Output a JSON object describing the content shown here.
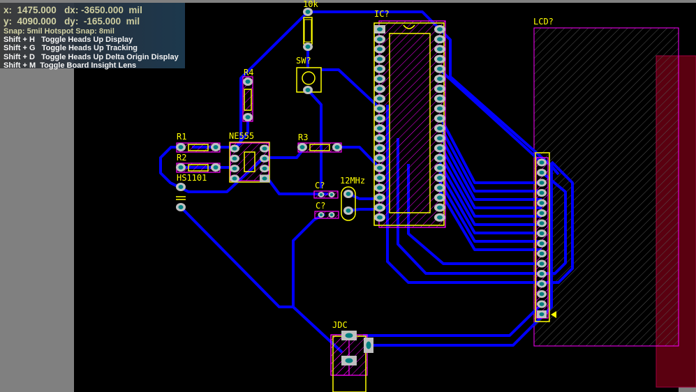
{
  "hud": {
    "x_line": "x:  1475.000   dx: -3650.000  mil",
    "y_line": "y:  4090.000   dy:  -165.000  mil",
    "snap": "Snap: 5mil Hotspot Snap: 8mil",
    "shortcuts": [
      "Shift + H   Toggle Heads Up Display",
      "Shift + G   Toggle Heads Up Tracking",
      "Shift + D   Toggle Heads Up Delta Origin Display",
      "Shift + M  Toggle Board Insight Lens"
    ]
  },
  "components": {
    "r10k": "10k",
    "ic": "IC?",
    "lcd": "LCD?",
    "sw": "SW?",
    "r4": "R4",
    "r1": "R1",
    "r2": "R2",
    "ne555": "NE555",
    "r3": "R3",
    "hs1101": "HS1101",
    "c1": "C?",
    "c2": "C?",
    "xtal": "12MHz",
    "jdc": "JDC"
  },
  "colors": {
    "board": "#000000",
    "track": "#0000ff",
    "silkscreen": "#ffff00",
    "courtyard": "#ff00ff",
    "pad": "#c0c0c0",
    "hole": "#008080",
    "keepout": "#800000"
  }
}
